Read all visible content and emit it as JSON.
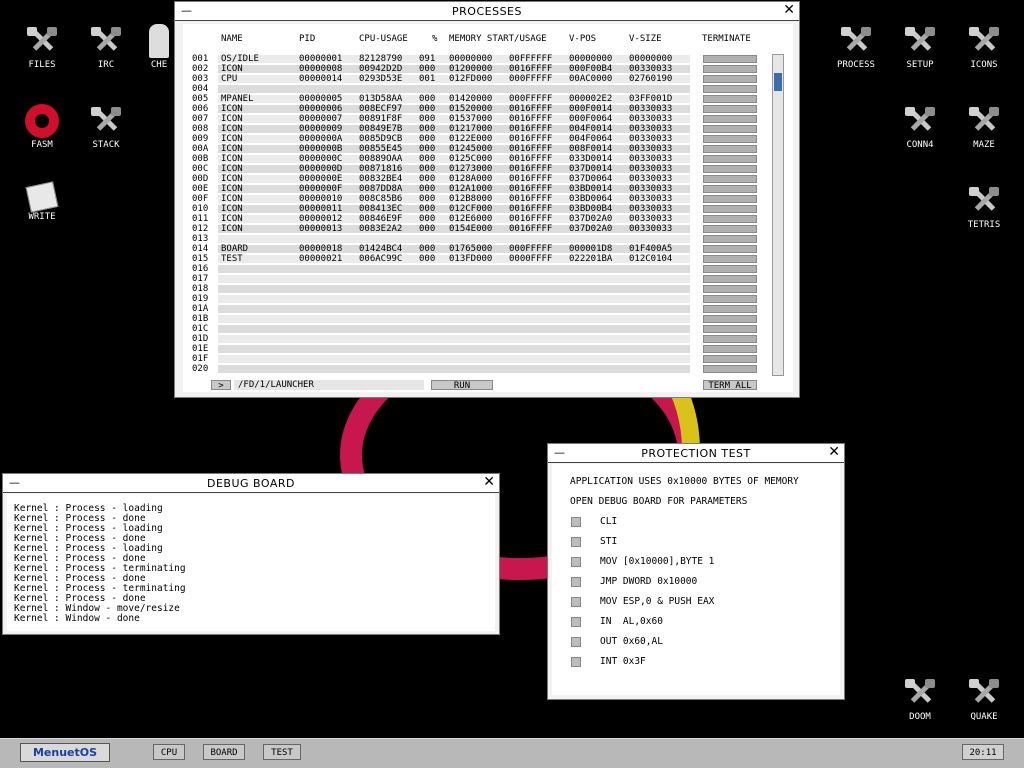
{
  "desktop": {
    "icons": [
      {
        "label": "FILES",
        "name": "files-icon"
      },
      {
        "label": "IRC",
        "name": "irc-icon"
      },
      {
        "label": "CHE",
        "name": "che-icon"
      },
      {
        "label": "FASM",
        "name": "fasm-icon"
      },
      {
        "label": "STACK",
        "name": "stack-icon"
      },
      {
        "label": "WRITE",
        "name": "write-icon"
      },
      {
        "label": "PROCESS",
        "name": "process-icon"
      },
      {
        "label": "SETUP",
        "name": "setup-icon"
      },
      {
        "label": "ICONS",
        "name": "icons-icon"
      },
      {
        "label": "CONN4",
        "name": "conn4-icon"
      },
      {
        "label": "MAZE",
        "name": "maze-icon"
      },
      {
        "label": "TETRIS",
        "name": "tetris-icon"
      },
      {
        "label": "DOOM",
        "name": "doom-icon"
      },
      {
        "label": "QUAKE",
        "name": "quake-icon"
      }
    ]
  },
  "processes": {
    "title": "PROCESSES",
    "minimize": "—",
    "close": "✕",
    "headers": {
      "name": "NAME",
      "pid": "PID",
      "cpu": "CPU-USAGE",
      "pct": "%",
      "mem": "MEMORY START/USAGE",
      "vpos": "V-POS",
      "vsize": "V-SIZE",
      "terminate": "TERMINATE"
    },
    "rows": [
      {
        "n": "001",
        "name": "OS/IDLE",
        "pid": "00000001",
        "cpu": "82128790",
        "pct": "091",
        "ms": "00000000",
        "mu": "00FFFFFF",
        "vpos": "00000000",
        "vsize": "00000000"
      },
      {
        "n": "002",
        "name": "ICON",
        "pid": "00000008",
        "cpu": "00942D2D",
        "pct": "000",
        "ms": "01200000",
        "mu": "0016FFFF",
        "vpos": "000F00B4",
        "vsize": "00330033"
      },
      {
        "n": "003",
        "name": "CPU",
        "pid": "00000014",
        "cpu": "0293D53E",
        "pct": "001",
        "ms": "012FD000",
        "mu": "000FFFFF",
        "vpos": "00AC0000",
        "vsize": "02760190"
      },
      {
        "n": "004",
        "name": "",
        "pid": "",
        "cpu": "",
        "pct": "",
        "ms": "",
        "mu": "",
        "vpos": "",
        "vsize": ""
      },
      {
        "n": "005",
        "name": "MPANEL",
        "pid": "00000005",
        "cpu": "013D58AA",
        "pct": "000",
        "ms": "01420000",
        "mu": "000FFFFF",
        "vpos": "000002E2",
        "vsize": "03FF001D"
      },
      {
        "n": "006",
        "name": "ICON",
        "pid": "00000006",
        "cpu": "008ECF97",
        "pct": "000",
        "ms": "01520000",
        "mu": "0016FFFF",
        "vpos": "000F0014",
        "vsize": "00330033"
      },
      {
        "n": "007",
        "name": "ICON",
        "pid": "00000007",
        "cpu": "00891F8F",
        "pct": "000",
        "ms": "01537000",
        "mu": "0016FFFF",
        "vpos": "000F0064",
        "vsize": "00330033"
      },
      {
        "n": "008",
        "name": "ICON",
        "pid": "00000009",
        "cpu": "00849E7B",
        "pct": "000",
        "ms": "01217000",
        "mu": "0016FFFF",
        "vpos": "004F0014",
        "vsize": "00330033"
      },
      {
        "n": "009",
        "name": "ICON",
        "pid": "0000000A",
        "cpu": "0085D9CB",
        "pct": "000",
        "ms": "0122E000",
        "mu": "0016FFFF",
        "vpos": "004F0064",
        "vsize": "00330033"
      },
      {
        "n": "00A",
        "name": "ICON",
        "pid": "0000000B",
        "cpu": "00855E45",
        "pct": "000",
        "ms": "01245000",
        "mu": "0016FFFF",
        "vpos": "008F0014",
        "vsize": "00330033"
      },
      {
        "n": "00B",
        "name": "ICON",
        "pid": "0000000C",
        "cpu": "00889OAA",
        "pct": "000",
        "ms": "0125C000",
        "mu": "0016FFFF",
        "vpos": "033D0014",
        "vsize": "00330033"
      },
      {
        "n": "00C",
        "name": "ICON",
        "pid": "0000000D",
        "cpu": "00871816",
        "pct": "000",
        "ms": "01273000",
        "mu": "0016FFFF",
        "vpos": "037D0014",
        "vsize": "00330033"
      },
      {
        "n": "00D",
        "name": "ICON",
        "pid": "0000000E",
        "cpu": "00832BE4",
        "pct": "000",
        "ms": "0128A000",
        "mu": "0016FFFF",
        "vpos": "037D0064",
        "vsize": "00330033"
      },
      {
        "n": "00E",
        "name": "ICON",
        "pid": "0000000F",
        "cpu": "0087DD8A",
        "pct": "000",
        "ms": "012A1000",
        "mu": "0016FFFF",
        "vpos": "03BD0014",
        "vsize": "00330033"
      },
      {
        "n": "00F",
        "name": "ICON",
        "pid": "00000010",
        "cpu": "008C85B6",
        "pct": "000",
        "ms": "012B8000",
        "mu": "0016FFFF",
        "vpos": "03BD0064",
        "vsize": "00330033"
      },
      {
        "n": "010",
        "name": "ICON",
        "pid": "00000011",
        "cpu": "008413EC",
        "pct": "000",
        "ms": "012CF000",
        "mu": "0016FFFF",
        "vpos": "03BD00B4",
        "vsize": "00330033"
      },
      {
        "n": "011",
        "name": "ICON",
        "pid": "00000012",
        "cpu": "00846E9F",
        "pct": "000",
        "ms": "012E6000",
        "mu": "0016FFFF",
        "vpos": "037D02A0",
        "vsize": "00330033"
      },
      {
        "n": "012",
        "name": "ICON",
        "pid": "00000013",
        "cpu": "0083E2A2",
        "pct": "000",
        "ms": "0154E000",
        "mu": "0016FFFF",
        "vpos": "037D02A0",
        "vsize": "00330033"
      },
      {
        "n": "013",
        "name": "",
        "pid": "",
        "cpu": "",
        "pct": "",
        "ms": "",
        "mu": "",
        "vpos": "",
        "vsize": ""
      },
      {
        "n": "014",
        "name": "BOARD",
        "pid": "00000018",
        "cpu": "01424BC4",
        "pct": "000",
        "ms": "01765000",
        "mu": "000FFFFF",
        "vpos": "000001D8",
        "vsize": "01F400A5"
      },
      {
        "n": "015",
        "name": "TEST",
        "pid": "00000021",
        "cpu": "006AC99C",
        "pct": "000",
        "ms": "013FD000",
        "mu": "0000FFFF",
        "vpos": "022201BA",
        "vsize": "012C0104"
      },
      {
        "n": "016",
        "name": "",
        "pid": "",
        "cpu": "",
        "pct": "",
        "ms": "",
        "mu": "",
        "vpos": "",
        "vsize": ""
      },
      {
        "n": "017",
        "name": "",
        "pid": "",
        "cpu": "",
        "pct": "",
        "ms": "",
        "mu": "",
        "vpos": "",
        "vsize": ""
      },
      {
        "n": "018",
        "name": "",
        "pid": "",
        "cpu": "",
        "pct": "",
        "ms": "",
        "mu": "",
        "vpos": "",
        "vsize": ""
      },
      {
        "n": "019",
        "name": "",
        "pid": "",
        "cpu": "",
        "pct": "",
        "ms": "",
        "mu": "",
        "vpos": "",
        "vsize": ""
      },
      {
        "n": "01A",
        "name": "",
        "pid": "",
        "cpu": "",
        "pct": "",
        "ms": "",
        "mu": "",
        "vpos": "",
        "vsize": ""
      },
      {
        "n": "01B",
        "name": "",
        "pid": "",
        "cpu": "",
        "pct": "",
        "ms": "",
        "mu": "",
        "vpos": "",
        "vsize": ""
      },
      {
        "n": "01C",
        "name": "",
        "pid": "",
        "cpu": "",
        "pct": "",
        "ms": "",
        "mu": "",
        "vpos": "",
        "vsize": ""
      },
      {
        "n": "01D",
        "name": "",
        "pid": "",
        "cpu": "",
        "pct": "",
        "ms": "",
        "mu": "",
        "vpos": "",
        "vsize": ""
      },
      {
        "n": "01E",
        "name": "",
        "pid": "",
        "cpu": "",
        "pct": "",
        "ms": "",
        "mu": "",
        "vpos": "",
        "vsize": ""
      },
      {
        "n": "01F",
        "name": "",
        "pid": "",
        "cpu": "",
        "pct": "",
        "ms": "",
        "mu": "",
        "vpos": "",
        "vsize": ""
      },
      {
        "n": "020",
        "name": "",
        "pid": "",
        "cpu": "",
        "pct": "",
        "ms": "",
        "mu": "",
        "vpos": "",
        "vsize": ""
      }
    ],
    "path_button": ">",
    "path_value": "/FD/1/LAUNCHER",
    "run_label": "RUN",
    "term_all_label": "TERM ALL"
  },
  "debug_board": {
    "title": "DEBUG BOARD",
    "minimize": "—",
    "close": "✕",
    "lines": [
      "Kernel : Process - loading",
      "Kernel : Process - done",
      "Kernel : Process - loading",
      "Kernel : Process - done",
      "Kernel : Process - loading",
      "Kernel : Process - done",
      "Kernel : Process - terminating",
      "Kernel : Process - done",
      "Kernel : Process - terminating",
      "Kernel : Process - done",
      "Kernel : Window - move/resize",
      "Kernel : Window - done"
    ]
  },
  "protection_test": {
    "title": "PROTECTION TEST",
    "minimize": "—",
    "close": "✕",
    "line1": "APPLICATION USES 0x10000 BYTES OF MEMORY",
    "line2": "OPEN DEBUG BOARD FOR PARAMETERS",
    "tests": [
      "CLI",
      "STI",
      "MOV [0x10000],BYTE 1",
      "JMP DWORD 0x10000",
      "MOV ESP,0 & PUSH EAX",
      "IN  AL,0x60",
      "OUT 0x60,AL",
      "INT 0x3F"
    ]
  },
  "taskbar": {
    "menu_label": "MenuetOS",
    "tasks": [
      "CPU",
      "BOARD",
      "TEST"
    ],
    "clock": "20:11"
  },
  "colors": {
    "accent": "#1a3fa0",
    "scroll_thumb": "#3b6db0"
  }
}
